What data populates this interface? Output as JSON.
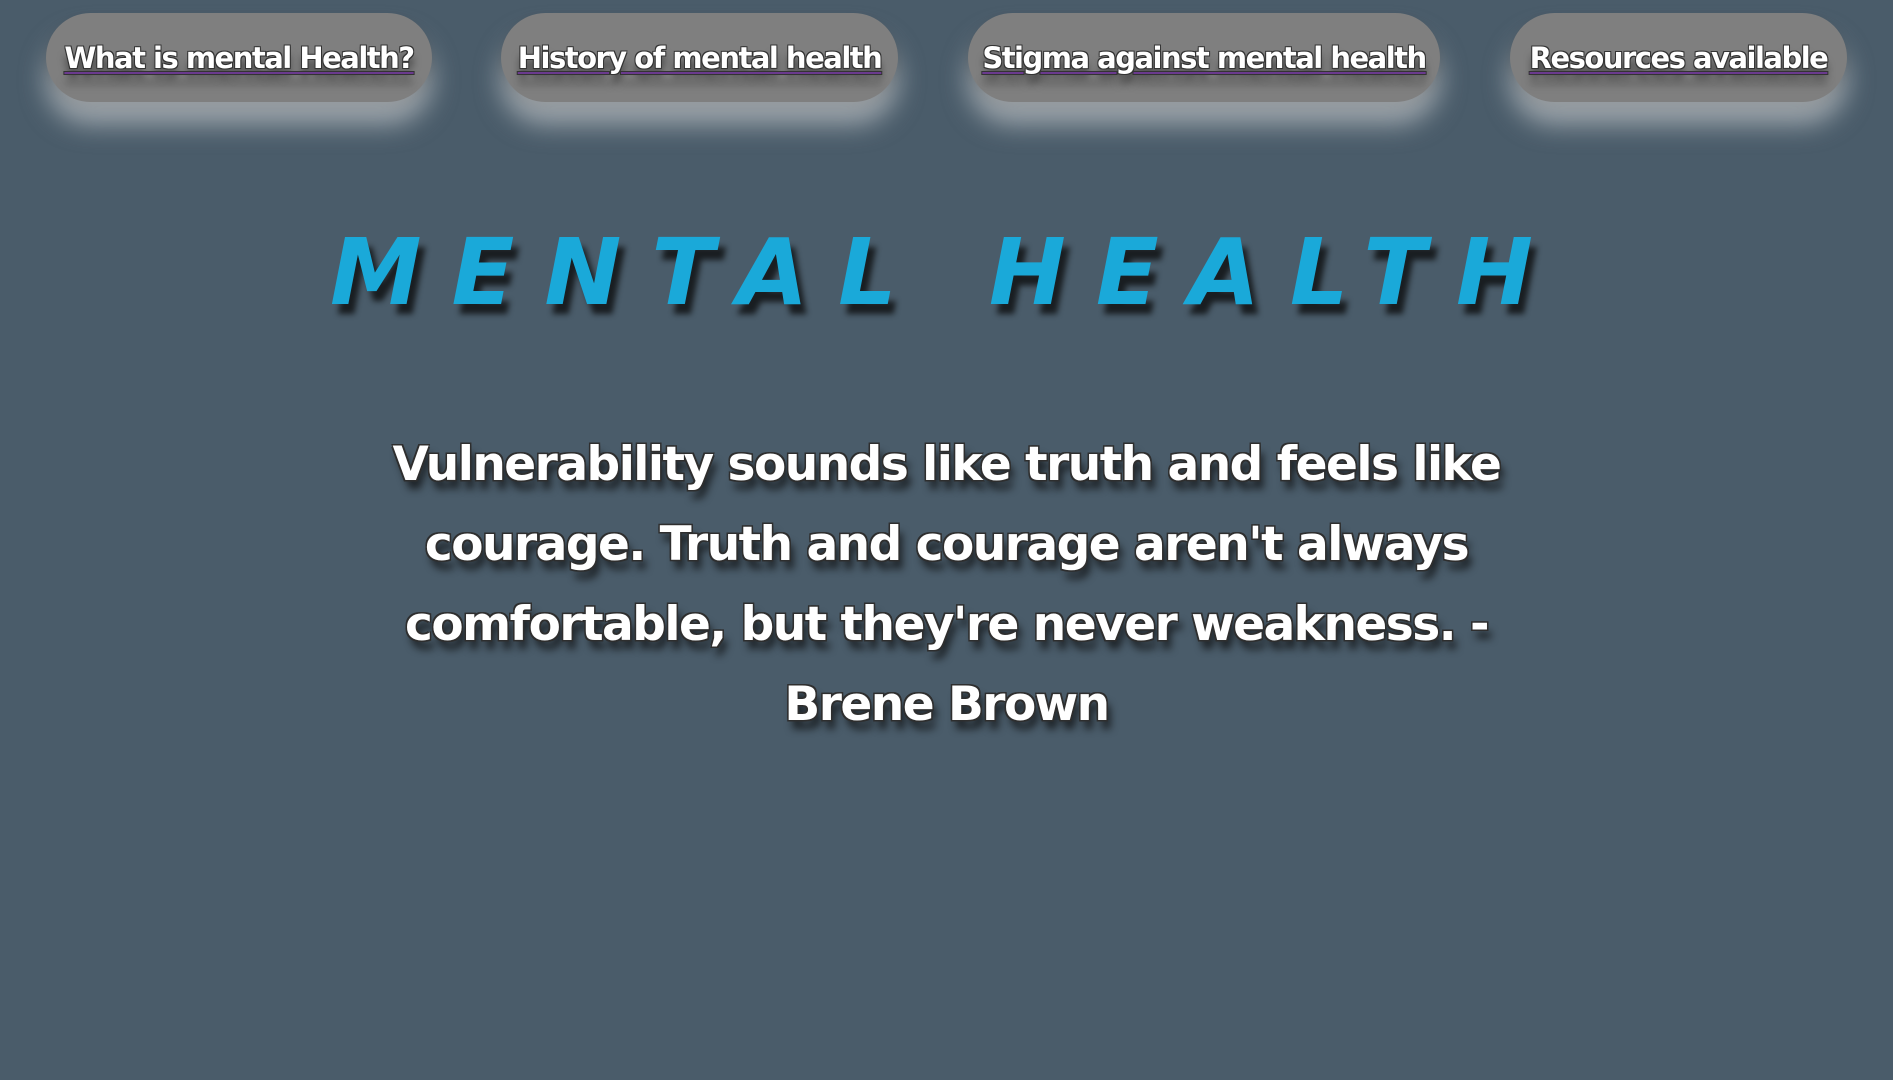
{
  "nav": {
    "items": [
      {
        "label": "What is mental Health?"
      },
      {
        "label": "History of mental health"
      },
      {
        "label": "Stigma against mental health"
      },
      {
        "label": "Resources available"
      }
    ]
  },
  "header": {
    "title": "MENTAL HEALTH"
  },
  "main": {
    "quote": "Vulnerability sounds like truth and feels like courage. Truth and courage aren't always comfortable, but they're never weakness. - Brene Brown"
  },
  "colors": {
    "background": "#4a5c6a",
    "button": "#7f7f7f",
    "title": "#1aa9d9",
    "text": "#ffffff"
  }
}
